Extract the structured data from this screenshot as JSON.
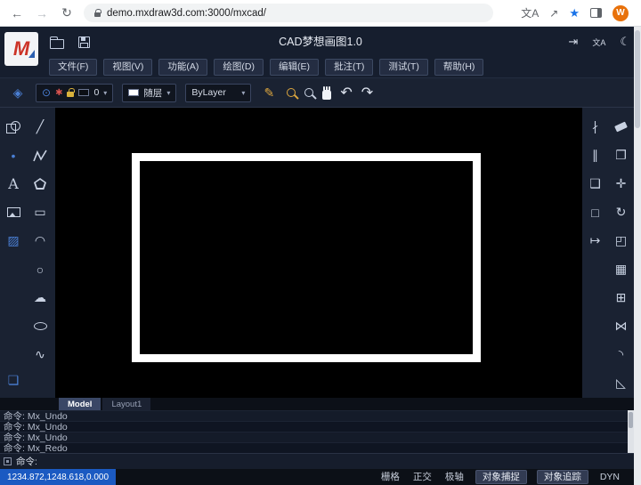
{
  "browser": {
    "url": "demo.mxdraw3d.com:3000/mxcad/",
    "avatar_letter": "W"
  },
  "header": {
    "title": "CAD梦想画图1.0",
    "logo_letter": "M"
  },
  "menus": [
    {
      "label": "文件(F)"
    },
    {
      "label": "视图(V)"
    },
    {
      "label": "功能(A)"
    },
    {
      "label": "绘图(D)"
    },
    {
      "label": "编辑(E)"
    },
    {
      "label": "批注(T)"
    },
    {
      "label": "测试(T)"
    },
    {
      "label": "帮助(H)"
    }
  ],
  "toolbar": {
    "layer_name": "0",
    "color_value": "随层",
    "linetype_value": "ByLayer"
  },
  "tabs": [
    {
      "label": "Model",
      "active": true
    },
    {
      "label": "Layout1",
      "active": false
    }
  ],
  "command": {
    "history": [
      {
        "text": "命令: Mx_Undo"
      },
      {
        "text": "命令: Mx_Undo"
      },
      {
        "text": "命令: Mx_Undo"
      },
      {
        "text": "命令: Mx_Redo"
      }
    ],
    "prompt": "命令:"
  },
  "status": {
    "coords": "1234.872,1248.618,0.000",
    "toggles": [
      {
        "label": "栅格",
        "active": false
      },
      {
        "label": "正交",
        "active": false
      },
      {
        "label": "极轴",
        "active": false
      },
      {
        "label": "对象捕捉",
        "active": true
      },
      {
        "label": "对象追踪",
        "active": true
      },
      {
        "label": "DYN",
        "active": false
      }
    ]
  },
  "colors": {
    "accent_blue": "#4a7fd4",
    "star_blue": "#1a73e8",
    "avatar_orange": "#e8710a",
    "coords_chip": "#1b5ac2",
    "canvas": "#000000",
    "rect_stroke": "#ffffff"
  },
  "icons": {
    "back": "←",
    "forward": "→",
    "reload": "↻",
    "share": "↗",
    "star": "★",
    "login": "⇥",
    "lang": "文A",
    "moon": "☾",
    "layers": "◈",
    "eye": "⊙",
    "freeze": "✱",
    "caret": "▾",
    "pen": "✎",
    "undo": "↶",
    "redo": "↷",
    "line": "╱",
    "point": "•",
    "text": "A",
    "hatch": "▨",
    "block": "❏",
    "rect": "▭",
    "arc": "◠",
    "circle": "○",
    "cloud": "☁",
    "spline": "∿",
    "xline": "∤",
    "offset": "∥",
    "solids": "❑",
    "viewport": "□",
    "extend": "↦",
    "copy": "❐",
    "move": "✛",
    "rotate": "↻",
    "scale": "◰",
    "array": "▦",
    "tiles": "⊞",
    "mirror": "⋈",
    "fillet": "◝",
    "chamfer": "◺"
  }
}
